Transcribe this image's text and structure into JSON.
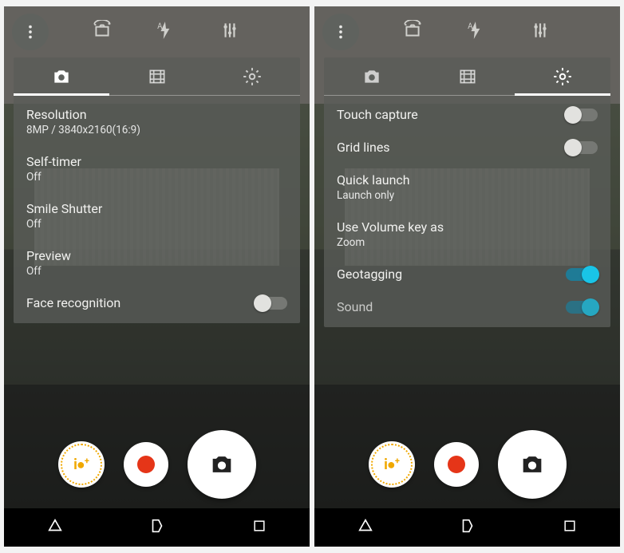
{
  "left": {
    "activeTab": "photo",
    "settings": {
      "resolution": {
        "label": "Resolution",
        "value": "8MP / 3840x2160(16:9)"
      },
      "selfTimer": {
        "label": "Self-timer",
        "value": "Off"
      },
      "smileShutter": {
        "label": "Smile Shutter",
        "value": "Off"
      },
      "preview": {
        "label": "Preview",
        "value": "Off"
      },
      "faceRecognition": {
        "label": "Face recognition",
        "on": false
      }
    }
  },
  "right": {
    "activeTab": "gear",
    "settings": {
      "touchCapture": {
        "label": "Touch capture",
        "on": false
      },
      "gridLines": {
        "label": "Grid lines",
        "on": false
      },
      "quickLaunch": {
        "label": "Quick launch",
        "value": "Launch only"
      },
      "volumeKey": {
        "label": "Use Volume key as",
        "value": "Zoom"
      },
      "geotagging": {
        "label": "Geotagging",
        "on": true
      },
      "sound": {
        "label": "Sound",
        "on": true
      }
    }
  },
  "modeBadge": {
    "text": "i●",
    "superscript": "+"
  },
  "icons": {
    "more": "more-vertical-icon",
    "switchCamera": "switch-camera-icon",
    "autoFlash": "auto-flash-icon",
    "sliders": "sliders-icon",
    "photoTab": "camera-icon",
    "videoTab": "film-icon",
    "gearTab": "gear-icon",
    "shutter": "camera-icon",
    "back": "back-icon",
    "home": "home-icon",
    "recent": "recent-icon"
  }
}
